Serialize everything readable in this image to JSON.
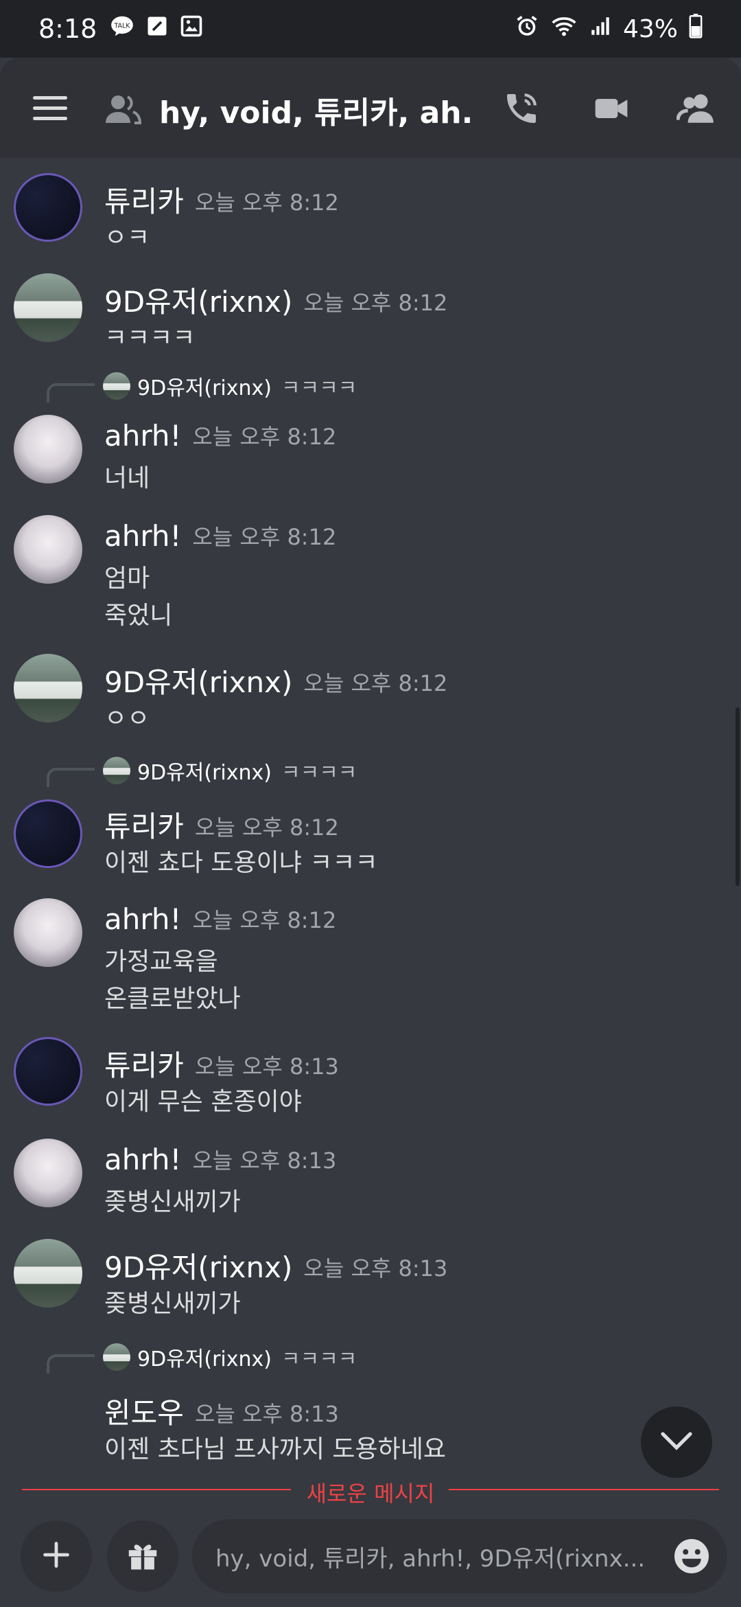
{
  "statusbar": {
    "time": "8:18",
    "left_icons": [
      "talk-icon",
      "note-icon",
      "image-icon"
    ],
    "right_icons": [
      "alarm-icon",
      "wifi-icon",
      "signal-icon"
    ],
    "battery": "43%"
  },
  "header": {
    "title": "hy, void, 튜리카, ah...",
    "icons": [
      "menu-icon",
      "group-icon",
      "call-icon",
      "video-icon",
      "members-icon"
    ]
  },
  "messages": [
    {
      "author": "튜리카",
      "stamp": "오늘 오후 8:12",
      "text": "ㅇㅋ"
    },
    {
      "author": "9D유저(rixnx)",
      "stamp": "오늘 오후 8:12",
      "text": "ㅋㅋㅋㅋ"
    },
    {
      "reply": {
        "author": "9D유저(rixnx)",
        "text": "ㅋㅋㅋㅋ"
      },
      "author": "ahrh!",
      "stamp": "오늘 오후 8:12",
      "text": "너네"
    },
    {
      "author": "ahrh!",
      "stamp": "오늘 오후 8:12",
      "text": "엄마\n죽었니"
    },
    {
      "author": "9D유저(rixnx)",
      "stamp": "오늘 오후 8:12",
      "text": "ㅇㅇ"
    },
    {
      "reply": {
        "author": "9D유저(rixnx)",
        "text": "ㅋㅋㅋㅋ"
      },
      "author": "튜리카",
      "stamp": "오늘 오후 8:12",
      "text": "이젠 쵸다 도용이냐 ㅋㅋㅋ"
    },
    {
      "author": "ahrh!",
      "stamp": "오늘 오후 8:12",
      "text": "가정교육을\n온클로받았나"
    },
    {
      "author": "튜리카",
      "stamp": "오늘 오후 8:13",
      "text": "이게 무슨 혼종이야"
    },
    {
      "author": "ahrh!",
      "stamp": "오늘 오후 8:13",
      "text": "좆병신새끼가"
    },
    {
      "author": "9D유저(rixnx)",
      "stamp": "오늘 오후 8:13",
      "text": "좆병신새끼가"
    },
    {
      "reply": {
        "author": "9D유저(rixnx)",
        "text": "ㅋㅋㅋㅋ"
      },
      "author": "윈도우",
      "stamp": "오늘 오후 8:13",
      "text": "이젠 초다님 프사까지 도용하네요"
    }
  ],
  "divider": {
    "label": "새로운 메시지"
  },
  "composer": {
    "placeholder": "hy, void, 튜리카, ahrh!, 9D유저(rixnx...",
    "icons": [
      "plus-icon",
      "gift-icon",
      "emoji-icon"
    ]
  },
  "jump_button": {
    "icon": "chevron-down-icon"
  }
}
